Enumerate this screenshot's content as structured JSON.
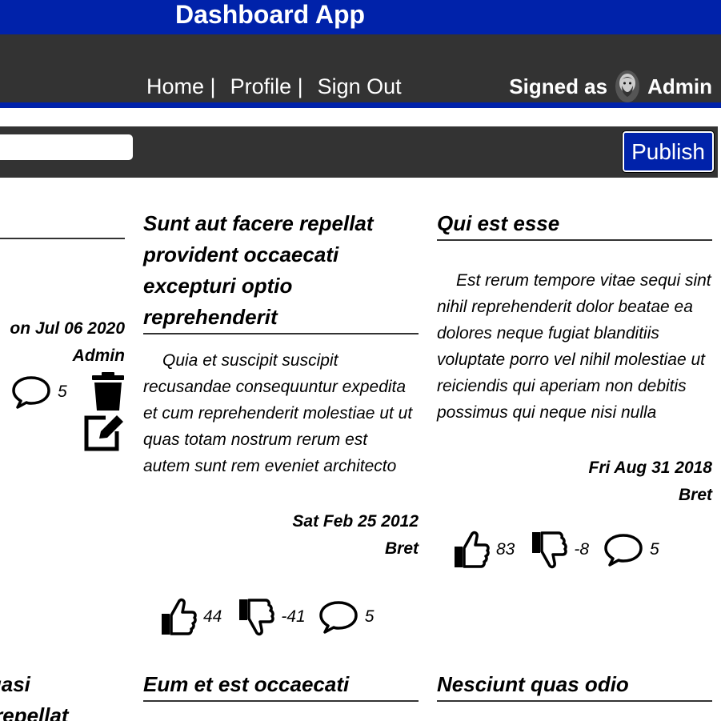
{
  "app": {
    "title": "Dashboard App"
  },
  "nav": {
    "home": "Home",
    "profile": "Profile",
    "signout": "Sign Out",
    "separator": "|"
  },
  "user": {
    "signed_as_label": "Signed as",
    "name": "Admin"
  },
  "toolbar": {
    "input_value": "",
    "publish_label": "Publish"
  },
  "posts": [
    {
      "title": "",
      "date": "on Jul 06 2020",
      "author": "Admin",
      "comments": "5",
      "actions": [
        "trash-icon",
        "edit-icon"
      ]
    },
    {
      "title": "Sunt aut facere repellat provident occaecati excepturi optio reprehenderit",
      "body": "Quia et suscipit suscipit recusandae consequuntur expedita et cum reprehenderit molestiae ut ut quas totam nostrum rerum est autem sunt rem eveniet architecto",
      "date": "Sat Feb 25 2012",
      "author": "Bret",
      "likes": "44",
      "dislikes": "-41",
      "comments": "5"
    },
    {
      "title": "Qui est esse",
      "body": "Est rerum tempore vitae sequi sint nihil reprehenderit dolor beatae ea dolores neque fugiat blanditiis voluptate porro vel nihil molestiae ut reiciendis qui aperiam non debitis possimus qui neque nisi nulla",
      "date": "Fri Aug 31 2018",
      "author": "Bret",
      "likes": "83",
      "dislikes": "-8",
      "comments": "5"
    },
    {
      "title": "quasi\nn repellat"
    },
    {
      "title": "Eum et est occaecati"
    },
    {
      "title": "Nesciunt quas odio"
    }
  ],
  "colors": {
    "brand": "#0022aa",
    "bar": "#333333"
  },
  "icons": {
    "like": "thumbs-up-icon",
    "dislike": "thumbs-down-icon",
    "comment": "comment-icon"
  }
}
